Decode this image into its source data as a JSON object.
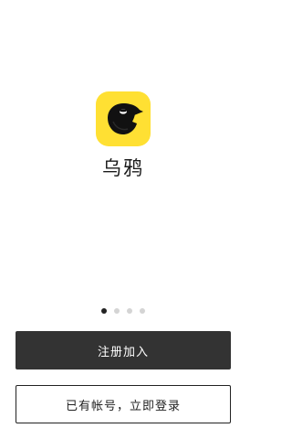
{
  "app": {
    "name": "乌鸦",
    "icon": "crow-app-icon",
    "icon_bg_color": "#FFE033",
    "bird_color": "#111111"
  },
  "pager": {
    "count": 4,
    "active_index": 0
  },
  "actions": {
    "register_label": "注册加入",
    "login_label": "已有帐号，立即登录",
    "register_bg": "#333333"
  }
}
